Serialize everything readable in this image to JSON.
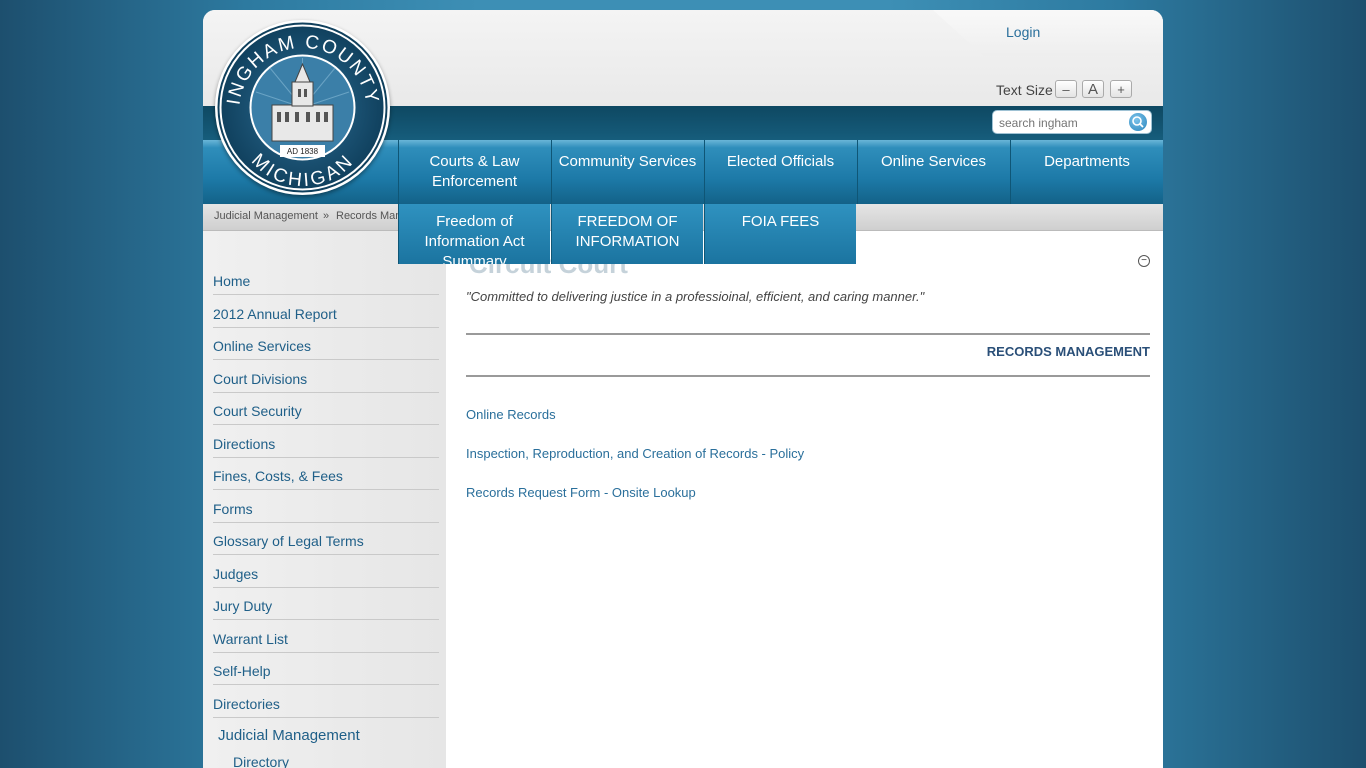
{
  "header": {
    "login": "Login",
    "text_size_label": "Text Size",
    "text_size_minus": "–",
    "text_size_reset": "A",
    "text_size_plus": "+",
    "search_placeholder": "search ingham"
  },
  "logo": {
    "top_text": "INGHAM COUNTY",
    "bottom_text": "MICHIGAN",
    "year": "AD 1838"
  },
  "nav": [
    {
      "label": "Courts & Law Enforcement"
    },
    {
      "label": "Community Services"
    },
    {
      "label": "Elected Officials"
    },
    {
      "label": "Online Services"
    },
    {
      "label": "Departments"
    }
  ],
  "dropdown": [
    {
      "label": "Freedom of Information Act Summary"
    },
    {
      "label": "FREEDOM OF INFORMATION"
    },
    {
      "label": "FOIA FEES"
    }
  ],
  "breadcrumb": {
    "item1": "Judicial Management",
    "separator": "»",
    "item2": "Records Man"
  },
  "sidebar": [
    "Home",
    "2012 Annual Report",
    "Online Services",
    "Court Divisions",
    "Court Security",
    "Directions",
    "Fines, Costs, & Fees",
    "Forms",
    "Glossary of Legal Terms",
    "Judges",
    "Jury Duty",
    "Warrant List",
    "Self-Help",
    "Directories"
  ],
  "sidebar_sub": {
    "section": "Judicial Management",
    "child": "Directory"
  },
  "content": {
    "title": "Circuit Court",
    "motto": "\"Committed to delivering justice in a professioinal, efficient, and caring manner.\"",
    "section_heading": "RECORDS MANAGEMENT",
    "links": [
      "Online Records",
      "Inspection, Reproduction, and Creation of Records - Policy",
      "Records Request Form - Onsite Lookup"
    ]
  }
}
